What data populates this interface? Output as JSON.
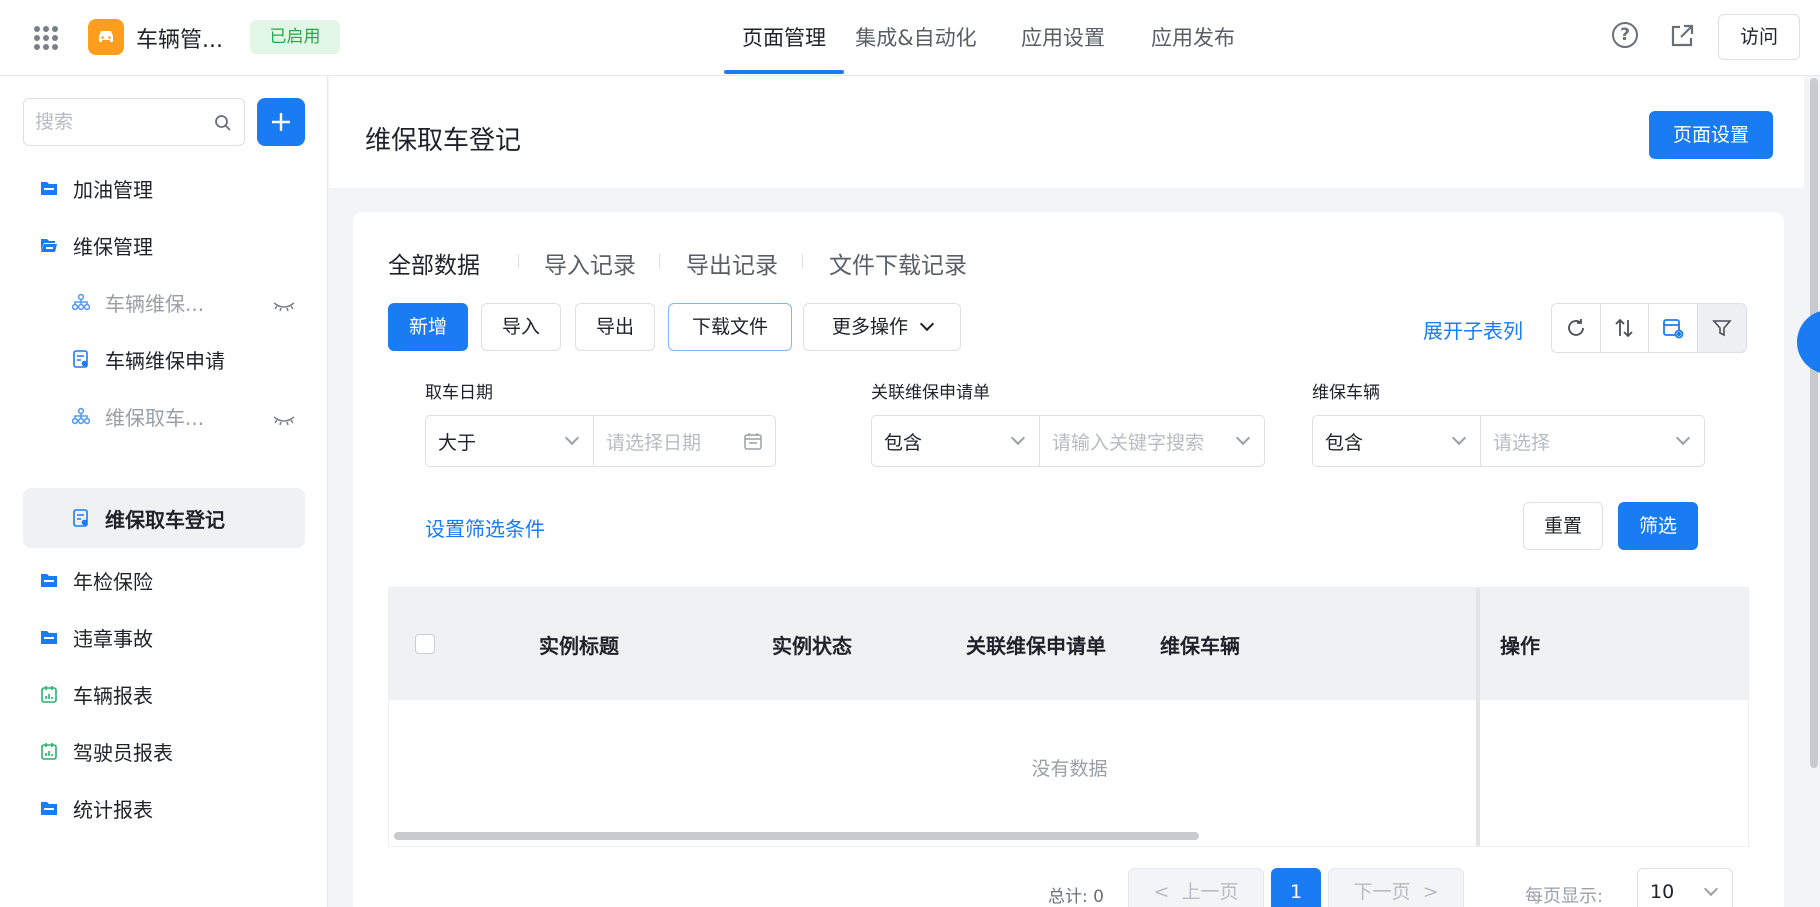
{
  "header": {
    "app_name": "车辆管...",
    "status": "已启用",
    "nav": [
      "页面管理",
      "集成&自动化",
      "应用设置",
      "应用发布"
    ],
    "active_nav": "页面管理",
    "visit_label": "访问"
  },
  "sidebar": {
    "search_placeholder": "搜索",
    "items": [
      {
        "label": "加油管理",
        "icon": "folder-icon",
        "level": "top"
      },
      {
        "label": "维保管理",
        "icon": "folder-open-icon",
        "level": "top"
      },
      {
        "label": "车辆维保...",
        "icon": "workflow-icon",
        "level": "child",
        "hidden": true
      },
      {
        "label": "车辆维保申请",
        "icon": "form-icon",
        "level": "child"
      },
      {
        "label": "维保取车...",
        "icon": "workflow-icon",
        "level": "child",
        "hidden": true
      },
      {
        "label": "维保取车登记",
        "icon": "form-icon",
        "level": "child",
        "active": true
      },
      {
        "label": "年检保险",
        "icon": "folder-icon",
        "level": "top"
      },
      {
        "label": "违章事故",
        "icon": "folder-icon",
        "level": "top"
      },
      {
        "label": "车辆报表",
        "icon": "report-icon",
        "level": "top"
      },
      {
        "label": "驾驶员报表",
        "icon": "report-icon",
        "level": "top"
      },
      {
        "label": "统计报表",
        "icon": "folder-icon",
        "level": "top"
      }
    ]
  },
  "page": {
    "title": "维保取车登记",
    "settings_label": "页面设置"
  },
  "tabs": [
    "全部数据",
    "导入记录",
    "导出记录",
    "文件下载记录"
  ],
  "toolbar": {
    "add": "新增",
    "import": "导入",
    "export": "导出",
    "download": "下载文件",
    "more": "更多操作",
    "expand_subtable": "展开子表列"
  },
  "filters": [
    {
      "label": "取车日期",
      "operator": "大于",
      "placeholder": "请选择日期"
    },
    {
      "label": "关联维保申请单",
      "operator": "包含",
      "placeholder": "请输入关键字搜索"
    },
    {
      "label": "维保车辆",
      "operator": "包含",
      "placeholder": "请选择"
    }
  ],
  "filter_actions": {
    "set_conditions": "设置筛选条件",
    "reset": "重置",
    "apply": "筛选"
  },
  "table": {
    "columns": [
      "实例标题",
      "实例状态",
      "关联维保申请单",
      "维保车辆",
      "操作"
    ],
    "empty_text": "没有数据"
  },
  "pagination": {
    "total": "总计: 0",
    "prev": "上一页",
    "current": "1",
    "next": "下一页",
    "page_size_label": "每页显示:",
    "page_size": "10"
  },
  "colors": {
    "accent": "#1a7cf2",
    "app_logo": "#ff9d1c",
    "status_badge_bg": "#e3f7e8",
    "status_badge_text": "#26a848"
  }
}
